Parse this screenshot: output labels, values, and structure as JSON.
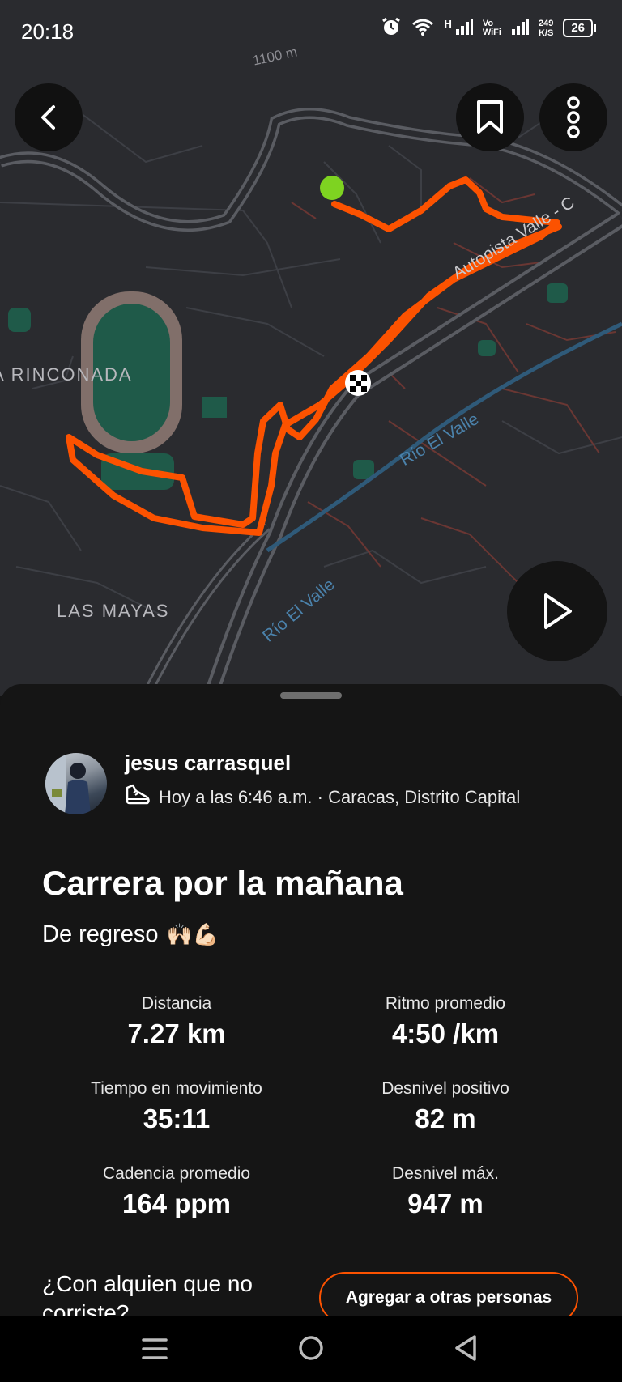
{
  "status_bar": {
    "time": "20:18",
    "network": "H",
    "vowifi": "Vo\nWiFi",
    "speed_value": "249",
    "speed_unit": "K/S",
    "battery": "26"
  },
  "map": {
    "labels": {
      "elevation": "1100 m",
      "rinconada": "A RINCONADA",
      "las_mayas": "LAS MAYAS",
      "autopista": "Autopista Valle - C",
      "rio_upper": "Río El Valle",
      "rio_lower": "Río El Valle"
    },
    "icons": {
      "back": "chevron-left-icon",
      "bookmark": "bookmark-icon",
      "more": "more-vertical-icon",
      "play": "play-icon"
    },
    "colors": {
      "route": "#fc5200",
      "start": "#7ed321",
      "background": "#2a2b2f",
      "park": "#1f5a49"
    }
  },
  "activity": {
    "athlete_name": "jesus carrasquel",
    "meta": "Hoy a las 6:46 a.m. · Caracas, Distrito Capital",
    "title": "Carrera por la mañana",
    "description": "De regreso",
    "description_emoji": "🙌🏻💪🏻",
    "stats": [
      {
        "label": "Distancia",
        "value": "7.27 km"
      },
      {
        "label": "Ritmo promedio",
        "value": "4:50 /km"
      },
      {
        "label": "Tiempo en movimiento",
        "value": "35:11"
      },
      {
        "label": "Desnivel positivo",
        "value": "82 m"
      },
      {
        "label": "Cadencia promedio",
        "value": "164 ppm"
      },
      {
        "label": "Desnivel máx.",
        "value": "947 m"
      }
    ],
    "tag_prompt": "¿Con alquien que no",
    "tag_prompt_cont": "corriste?",
    "add_people_label": "Agregar a otras personas"
  },
  "nav_bar": {
    "icons": [
      "menu-icon",
      "home-circle-icon",
      "back-triangle-icon"
    ]
  }
}
